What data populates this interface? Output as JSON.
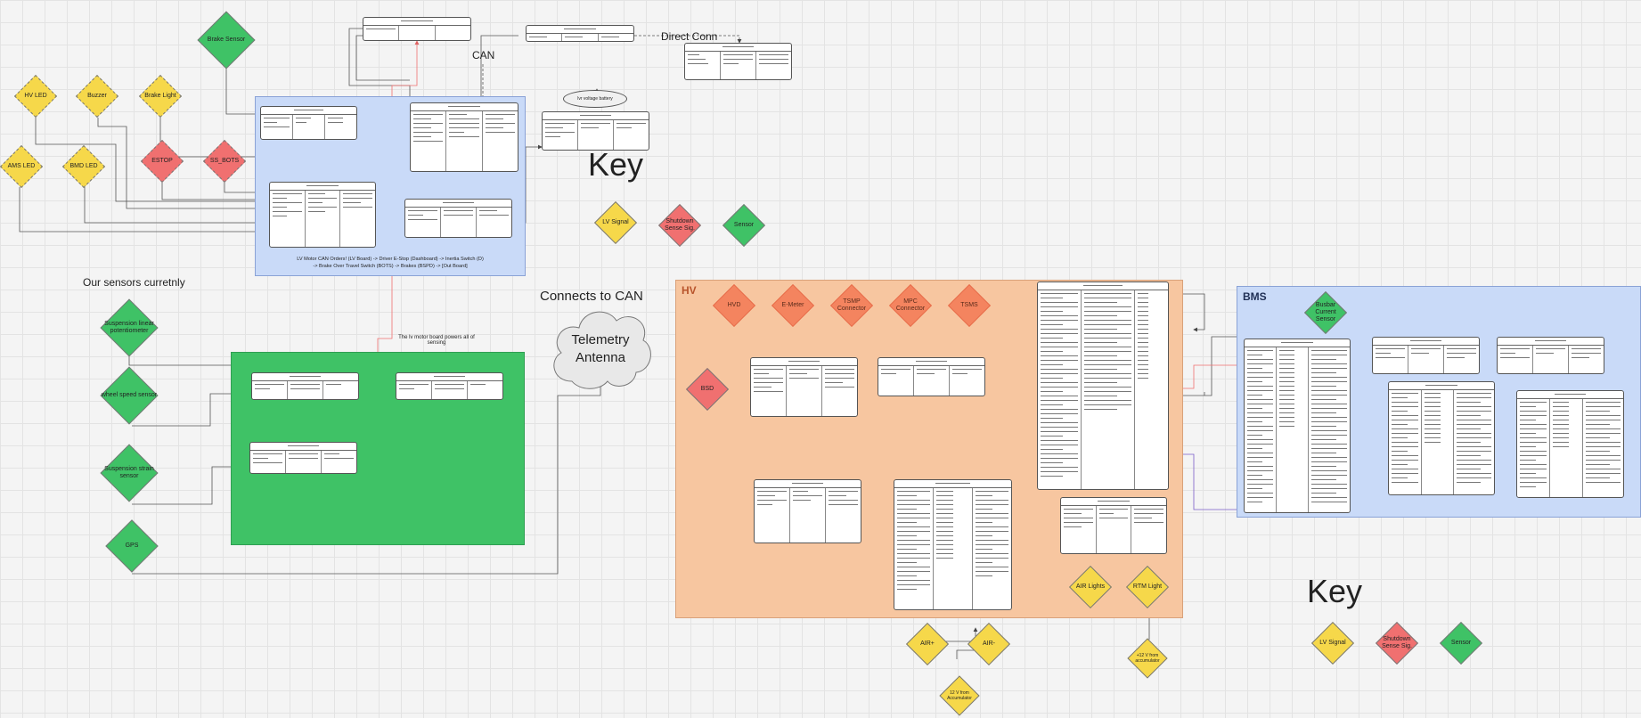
{
  "labels": {
    "can": "CAN",
    "direct_conn": "Direct Conn",
    "key_1": "Key",
    "key_2": "Key",
    "our_sensors": "Our sensors curretnly",
    "connects_to_can": "Connects to CAN",
    "telemetry_antenna": "Telemetry Antenna",
    "lv_caption_line1": "LV Motor CAN Orders! (LV Board) -> Driver E-Stop (Dashboard) -> Inertia Switch (D)",
    "lv_caption_line2": "-> Brake Over Travel Switch (BOTS) -> Brakes (BSPD) -> [Out Board]",
    "sensor_board_note": "The lv motor board powers all of sensing",
    "lv_battery_bubble": "lvr voltage battery",
    "hv_region": "HV",
    "bms_region": "BMS"
  },
  "diamonds": {
    "brake_sensor": "Brake Sensor",
    "hv_led": "HV LED",
    "buzzer": "Buzzer",
    "brake_light": "Brake Light",
    "ams_led": "AMS LED",
    "bmd_led": "BMD LED",
    "estop": "ESTOP",
    "ss_bots": "SS_BOTS",
    "key1_lv": "LV Signal",
    "key1_shutdown": "Shutdown Sense Sig.",
    "key1_sensor": "Sensor",
    "susp_pot": "Suspension linear potentiometer",
    "wheel_speed": "wheel speed sensor",
    "susp_strain": "Suspension strain sensor",
    "gps": "GPS",
    "hv_1": "HVD",
    "hv_2": "E-Meter",
    "hv_3": "TSMP Connector",
    "hv_4": "MPC Connector",
    "hv_5": "TSMS",
    "bsd": "BSD",
    "bms_sensor": "Busbar Current Sensor",
    "amb_lights": "AIR Lights",
    "rtm_light": "RTM Light",
    "air_plus": "AIR+",
    "air_minus": "AIR-",
    "bottom_1": "12 V from Accumulator",
    "bottom_2": "+12 V from accumulator",
    "key2_lv": "LV Signal",
    "key2_shutdown": "Shutdown Sense Sig.",
    "key2_sensor": "Sensor"
  },
  "colors": {
    "lv_signal": "#f6d84a",
    "shutdown": "#f07070",
    "sensor": "#3fc266",
    "hv_region": "#f7c6a0",
    "hv_diamond": "#f4845f",
    "lv_region": "#c9daf8",
    "sensor_region": "#3fc266",
    "wire_red": "#f07070",
    "wire_purple": "#7b5cc9",
    "wire_gray": "#555555"
  }
}
